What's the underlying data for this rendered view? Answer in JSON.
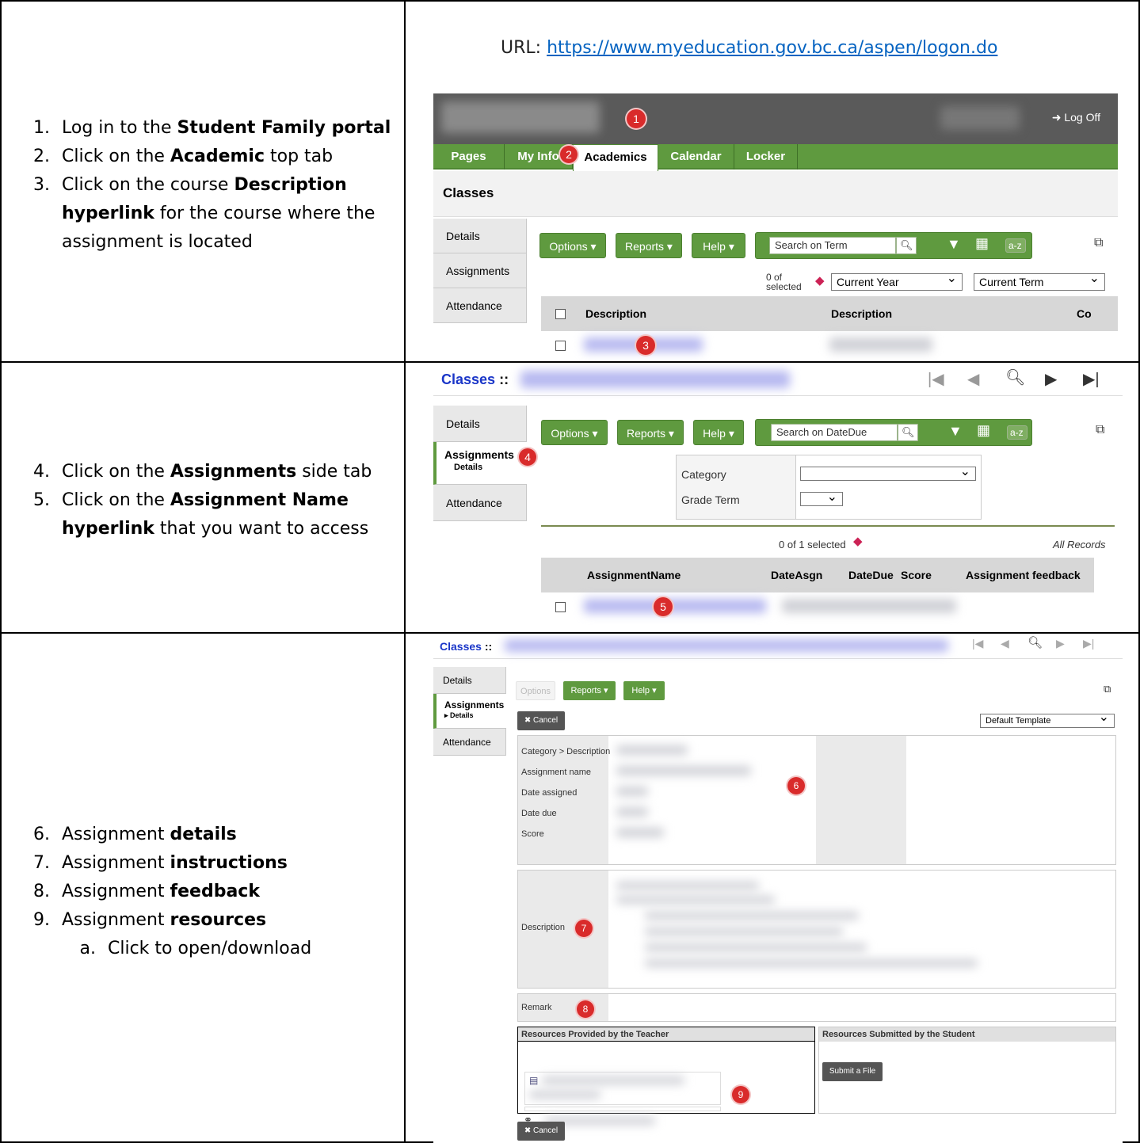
{
  "url": {
    "prefix": "URL: ",
    "link": "https://www.myeducation.gov.bc.ca/aspen/logon.do"
  },
  "step_groups": [
    {
      "items": [
        {
          "num": "1.",
          "pre": "Log in to the ",
          "bold": "Student Family portal",
          "post": ""
        },
        {
          "num": "2.",
          "pre": "Click on the ",
          "bold": "Academic",
          "post": " top tab"
        },
        {
          "num": "3.",
          "pre": "Click on the course ",
          "bold": "Description hyperlink",
          "post": " for the course where the assignment is located"
        }
      ]
    },
    {
      "items": [
        {
          "num": "4.",
          "pre": "Click on the ",
          "bold": "Assignments",
          "post": " side tab"
        },
        {
          "num": "5.",
          "pre": "Click on the ",
          "bold": "Assignment Name hyperlink",
          "post": " that you want to access"
        }
      ]
    },
    {
      "items": [
        {
          "num": "6.",
          "pre": "Assignment ",
          "bold": "details",
          "post": ""
        },
        {
          "num": "7.",
          "pre": "Assignment ",
          "bold": "instructions",
          "post": ""
        },
        {
          "num": "8.",
          "pre": "Assignment ",
          "bold": "feedback",
          "post": ""
        },
        {
          "num": "9.",
          "pre": "Assignment ",
          "bold": "resources",
          "post": ""
        }
      ],
      "sub": "Click to open/download"
    }
  ],
  "shot1": {
    "logoff": "Log Off",
    "tabs": [
      "Pages",
      "My Info",
      "Academics",
      "Calendar",
      "Locker"
    ],
    "title": "Classes",
    "side_tabs": [
      "Details",
      "Assignments",
      "Attendance"
    ],
    "buttons": {
      "options": "Options",
      "reports": "Reports",
      "help": "Help"
    },
    "search_placeholder": "Search on Term",
    "az": "a-z",
    "selected_text_1": "0 of",
    "selected_text_2": "selected",
    "year_select": "Current Year",
    "term_select": "Current Term",
    "columns": [
      "Description",
      "Description",
      "Co"
    ],
    "badges": [
      "1",
      "2",
      "3"
    ]
  },
  "shot2": {
    "title": "Classes",
    "title_sep": "::",
    "side_tabs": [
      "Details",
      "Assignments",
      "Details",
      "Attendance"
    ],
    "buttons": {
      "options": "Options",
      "reports": "Reports",
      "help": "Help"
    },
    "search_placeholder": "Search on DateDue",
    "az": "a-z",
    "filters": [
      "Category",
      "Grade Term"
    ],
    "selected_text": "0 of 1 selected",
    "all_records": "All Records",
    "columns": [
      "AssignmentName",
      "DateAsgn",
      "DateDue",
      "Score",
      "Assignment feedback"
    ],
    "badges": [
      "4",
      "5"
    ]
  },
  "shot3": {
    "title": "Classes",
    "title_sep": "::",
    "side_tabs": [
      "Details",
      "Assignments",
      "Details",
      "Attendance"
    ],
    "buttons": {
      "options": "Options",
      "reports": "Reports",
      "help": "Help"
    },
    "cancel": "Cancel",
    "template": "Default Template",
    "fields": [
      "Category > Description",
      "Assignment name",
      "Date assigned",
      "Date due",
      "Score"
    ],
    "description_label": "Description",
    "remark_label": "Remark",
    "teacher_resources": "Resources Provided by the Teacher",
    "student_resources": "Resources Submitted by the Student",
    "submit_file": "Submit a File",
    "badges": [
      "6",
      "7",
      "8",
      "9"
    ]
  }
}
